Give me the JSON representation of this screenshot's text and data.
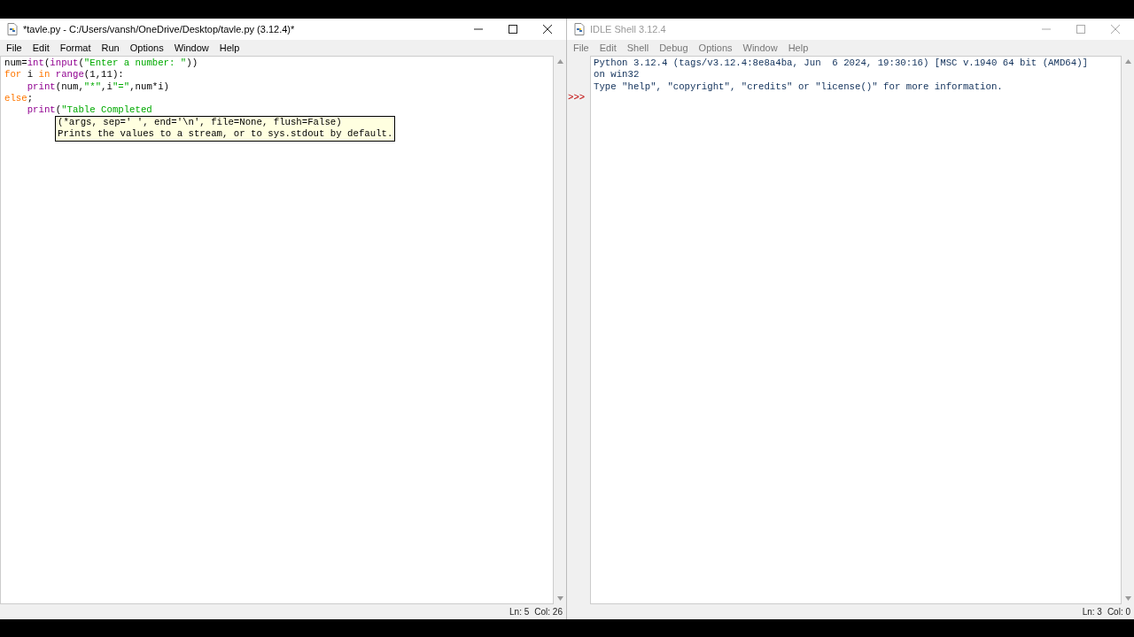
{
  "editor_window": {
    "title": "*tavle.py - C:/Users/vansh/OneDrive/Desktop/tavle.py (3.12.4)*",
    "active": true,
    "menu": [
      "File",
      "Edit",
      "Format",
      "Run",
      "Options",
      "Window",
      "Help"
    ],
    "code_lines": [
      [
        {
          "kind": "plain",
          "text": "num="
        },
        {
          "kind": "builtin",
          "text": "int"
        },
        {
          "kind": "plain",
          "text": "("
        },
        {
          "kind": "builtin",
          "text": "input"
        },
        {
          "kind": "plain",
          "text": "("
        },
        {
          "kind": "string",
          "text": "\"Enter a number: \""
        },
        {
          "kind": "plain",
          "text": "))"
        }
      ],
      [
        {
          "kind": "keyword",
          "text": "for"
        },
        {
          "kind": "plain",
          "text": " i "
        },
        {
          "kind": "keyword",
          "text": "in"
        },
        {
          "kind": "builtin",
          "text": " range"
        },
        {
          "kind": "plain",
          "text": "(1,11):"
        }
      ],
      [
        {
          "kind": "builtin",
          "text": "    print"
        },
        {
          "kind": "plain",
          "text": "(num,"
        },
        {
          "kind": "string",
          "text": "\"*\""
        },
        {
          "kind": "plain",
          "text": ",i"
        },
        {
          "kind": "string",
          "text": "\"=\""
        },
        {
          "kind": "plain",
          "text": ",num*i)"
        }
      ],
      [
        {
          "kind": "keyword",
          "text": "else"
        },
        {
          "kind": "plain",
          "text": ";"
        }
      ],
      [
        {
          "kind": "builtin",
          "text": "    print"
        },
        {
          "kind": "plain",
          "text": "("
        },
        {
          "kind": "string",
          "text": "\"Table Completed"
        }
      ]
    ],
    "calltip": [
      "(*args, sep=' ', end='\\n', file=None, flush=False)",
      "Prints the values to a stream, or to sys.stdout by default."
    ],
    "status": {
      "line": "Ln: 5",
      "col": "Col: 26"
    }
  },
  "shell_window": {
    "title": "IDLE Shell 3.12.4",
    "active": false,
    "menu": [
      "File",
      "Edit",
      "Shell",
      "Debug",
      "Options",
      "Window",
      "Help"
    ],
    "output_lines": [
      "Python 3.12.4 (tags/v3.12.4:8e8a4ba, Jun  6 2024, 19:30:16) [MSC v.1940 64 bit (AMD64)]",
      "on win32",
      "Type \"help\", \"copyright\", \"credits\" or \"license()\" for more information."
    ],
    "prompt": ">>>",
    "status": {
      "line": "Ln: 3",
      "col": "Col: 0"
    }
  }
}
